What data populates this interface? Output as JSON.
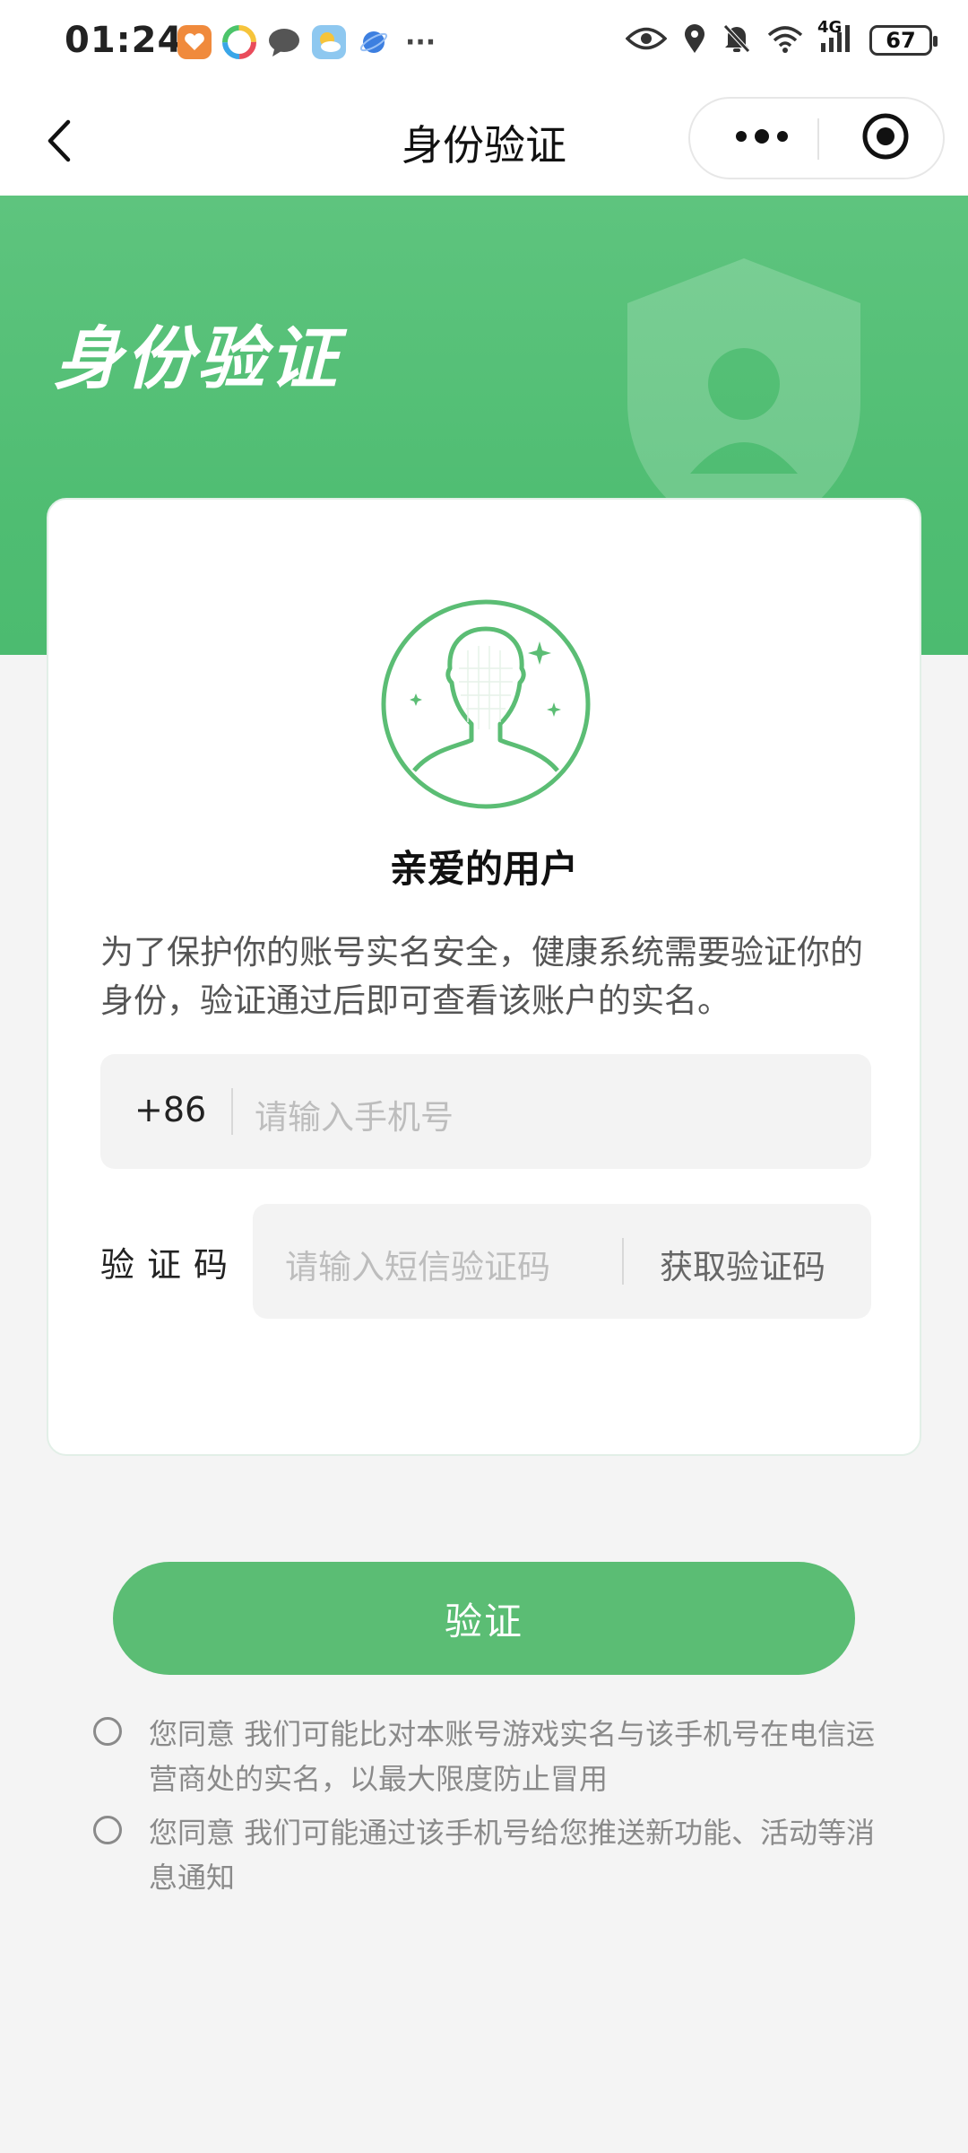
{
  "status_bar": {
    "time": "01:24",
    "battery": "67",
    "network": "4G",
    "icons": [
      "eye-icon",
      "location-icon",
      "mute-icon",
      "wifi-icon",
      "signal-icon"
    ],
    "more": "···"
  },
  "nav": {
    "title": "身份验证",
    "back_icon": "chevron-left-icon",
    "more_icon": "more-dots-icon",
    "close_icon": "target-close-icon"
  },
  "banner": {
    "title": "身份验证"
  },
  "card": {
    "greeting": "亲爱的用户",
    "description": "为了保护你的账号实名安全，健康系统需要验证你的身份，验证通过后即可查看该账户的实名。",
    "country_code": "+86",
    "phone_placeholder": "请输入手机号",
    "code_label": "验证码",
    "code_placeholder": "请输入短信验证码",
    "get_code_label": "获取验证码"
  },
  "verify_button": "验证",
  "agreements": [
    {
      "text": "您同意 我们可能比对本账号游戏实名与该手机号在电信运营商处的实名，以最大限度防止冒用",
      "checked": false
    },
    {
      "text": "您同意 我们可能通过该手机号给您推送新功能、活动等消息通知",
      "checked": false
    }
  ],
  "colors": {
    "accent": "#5bbd74",
    "banner": "#55c077",
    "background": "#f4f4f4"
  }
}
